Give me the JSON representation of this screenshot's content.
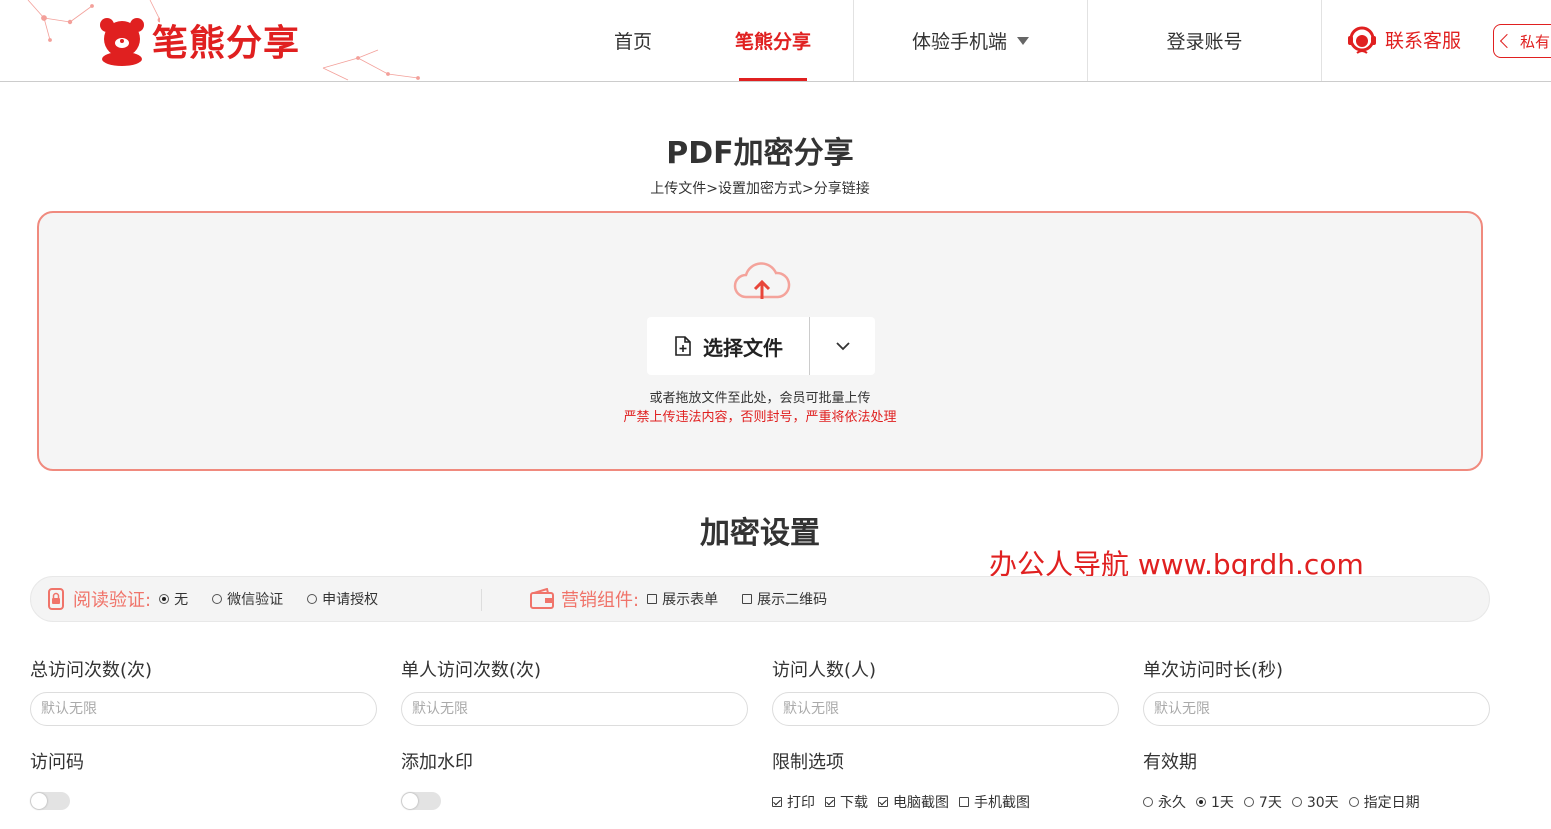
{
  "header": {
    "logo_text": "笔熊分享",
    "nav": [
      {
        "label": "首页"
      },
      {
        "label": "笔熊分享"
      },
      {
        "label": "体验手机端"
      },
      {
        "label": "登录账号"
      }
    ],
    "service_label": "联系客服",
    "private_label": "私有"
  },
  "upload": {
    "title": "PDF加密分享",
    "steps": "上传文件>设置加密方式>分享链接",
    "choose_label": "选择文件",
    "hint": "或者拖放文件至此处，会员可批量上传",
    "warning": "严禁上传违法内容，否则封号，严重将依法处理"
  },
  "settings": {
    "title": "加密设置",
    "watermark_text": "办公人导航 www.bgrdh.com",
    "read_verify": {
      "label": "阅读验证:",
      "options": [
        {
          "label": "无",
          "selected": true
        },
        {
          "label": "微信验证",
          "selected": false
        },
        {
          "label": "申请授权",
          "selected": false
        }
      ]
    },
    "marketing": {
      "label": "营销组件:",
      "options": [
        {
          "label": "展示表单",
          "checked": false
        },
        {
          "label": "展示二维码",
          "checked": false
        }
      ]
    },
    "fields": [
      {
        "label": "总访问次数(次)",
        "placeholder": "默认无限"
      },
      {
        "label": "单人访问次数(次)",
        "placeholder": "默认无限"
      },
      {
        "label": "访问人数(人)",
        "placeholder": "默认无限"
      },
      {
        "label": "单次访问时长(秒)",
        "placeholder": "默认无限"
      }
    ],
    "access_code": {
      "label": "访问码",
      "enabled": false
    },
    "watermark_toggle": {
      "label": "添加水印",
      "enabled": false
    },
    "restrictions": {
      "label": "限制选项",
      "options": [
        {
          "label": "打印",
          "checked": true
        },
        {
          "label": "下载",
          "checked": true
        },
        {
          "label": "电脑截图",
          "checked": true
        },
        {
          "label": "手机截图",
          "checked": false
        }
      ]
    },
    "validity": {
      "label": "有效期",
      "options": [
        {
          "label": "永久",
          "selected": false
        },
        {
          "label": "1天",
          "selected": true
        },
        {
          "label": "7天",
          "selected": false
        },
        {
          "label": "30天",
          "selected": false
        },
        {
          "label": "指定日期",
          "selected": false
        }
      ]
    }
  },
  "colors": {
    "brand": "#e02020",
    "accent_light": "#f08a7e"
  }
}
